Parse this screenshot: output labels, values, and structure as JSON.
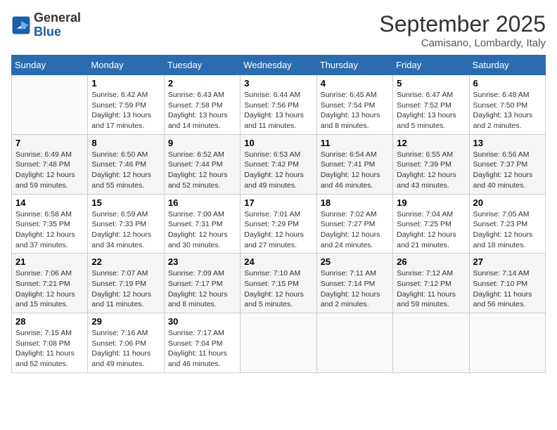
{
  "logo": {
    "line1": "General",
    "line2": "Blue"
  },
  "title": "September 2025",
  "location": "Camisano, Lombardy, Italy",
  "weekdays": [
    "Sunday",
    "Monday",
    "Tuesday",
    "Wednesday",
    "Thursday",
    "Friday",
    "Saturday"
  ],
  "weeks": [
    [
      {
        "day": null
      },
      {
        "day": 1,
        "sunrise": "6:42 AM",
        "sunset": "7:59 PM",
        "daylight": "13 hours and 17 minutes."
      },
      {
        "day": 2,
        "sunrise": "6:43 AM",
        "sunset": "7:58 PM",
        "daylight": "13 hours and 14 minutes."
      },
      {
        "day": 3,
        "sunrise": "6:44 AM",
        "sunset": "7:56 PM",
        "daylight": "13 hours and 11 minutes."
      },
      {
        "day": 4,
        "sunrise": "6:45 AM",
        "sunset": "7:54 PM",
        "daylight": "13 hours and 8 minutes."
      },
      {
        "day": 5,
        "sunrise": "6:47 AM",
        "sunset": "7:52 PM",
        "daylight": "13 hours and 5 minutes."
      },
      {
        "day": 6,
        "sunrise": "6:48 AM",
        "sunset": "7:50 PM",
        "daylight": "13 hours and 2 minutes."
      }
    ],
    [
      {
        "day": 7,
        "sunrise": "6:49 AM",
        "sunset": "7:48 PM",
        "daylight": "12 hours and 59 minutes."
      },
      {
        "day": 8,
        "sunrise": "6:50 AM",
        "sunset": "7:46 PM",
        "daylight": "12 hours and 55 minutes."
      },
      {
        "day": 9,
        "sunrise": "6:52 AM",
        "sunset": "7:44 PM",
        "daylight": "12 hours and 52 minutes."
      },
      {
        "day": 10,
        "sunrise": "6:53 AM",
        "sunset": "7:42 PM",
        "daylight": "12 hours and 49 minutes."
      },
      {
        "day": 11,
        "sunrise": "6:54 AM",
        "sunset": "7:41 PM",
        "daylight": "12 hours and 46 minutes."
      },
      {
        "day": 12,
        "sunrise": "6:55 AM",
        "sunset": "7:39 PM",
        "daylight": "12 hours and 43 minutes."
      },
      {
        "day": 13,
        "sunrise": "6:56 AM",
        "sunset": "7:37 PM",
        "daylight": "12 hours and 40 minutes."
      }
    ],
    [
      {
        "day": 14,
        "sunrise": "6:58 AM",
        "sunset": "7:35 PM",
        "daylight": "12 hours and 37 minutes."
      },
      {
        "day": 15,
        "sunrise": "6:59 AM",
        "sunset": "7:33 PM",
        "daylight": "12 hours and 34 minutes."
      },
      {
        "day": 16,
        "sunrise": "7:00 AM",
        "sunset": "7:31 PM",
        "daylight": "12 hours and 30 minutes."
      },
      {
        "day": 17,
        "sunrise": "7:01 AM",
        "sunset": "7:29 PM",
        "daylight": "12 hours and 27 minutes."
      },
      {
        "day": 18,
        "sunrise": "7:02 AM",
        "sunset": "7:27 PM",
        "daylight": "12 hours and 24 minutes."
      },
      {
        "day": 19,
        "sunrise": "7:04 AM",
        "sunset": "7:25 PM",
        "daylight": "12 hours and 21 minutes."
      },
      {
        "day": 20,
        "sunrise": "7:05 AM",
        "sunset": "7:23 PM",
        "daylight": "12 hours and 18 minutes."
      }
    ],
    [
      {
        "day": 21,
        "sunrise": "7:06 AM",
        "sunset": "7:21 PM",
        "daylight": "12 hours and 15 minutes."
      },
      {
        "day": 22,
        "sunrise": "7:07 AM",
        "sunset": "7:19 PM",
        "daylight": "12 hours and 11 minutes."
      },
      {
        "day": 23,
        "sunrise": "7:09 AM",
        "sunset": "7:17 PM",
        "daylight": "12 hours and 8 minutes."
      },
      {
        "day": 24,
        "sunrise": "7:10 AM",
        "sunset": "7:15 PM",
        "daylight": "12 hours and 5 minutes."
      },
      {
        "day": 25,
        "sunrise": "7:11 AM",
        "sunset": "7:14 PM",
        "daylight": "12 hours and 2 minutes."
      },
      {
        "day": 26,
        "sunrise": "7:12 AM",
        "sunset": "7:12 PM",
        "daylight": "11 hours and 59 minutes."
      },
      {
        "day": 27,
        "sunrise": "7:14 AM",
        "sunset": "7:10 PM",
        "daylight": "11 hours and 56 minutes."
      }
    ],
    [
      {
        "day": 28,
        "sunrise": "7:15 AM",
        "sunset": "7:08 PM",
        "daylight": "11 hours and 52 minutes."
      },
      {
        "day": 29,
        "sunrise": "7:16 AM",
        "sunset": "7:06 PM",
        "daylight": "11 hours and 49 minutes."
      },
      {
        "day": 30,
        "sunrise": "7:17 AM",
        "sunset": "7:04 PM",
        "daylight": "11 hours and 46 minutes."
      },
      {
        "day": null
      },
      {
        "day": null
      },
      {
        "day": null
      },
      {
        "day": null
      }
    ]
  ]
}
